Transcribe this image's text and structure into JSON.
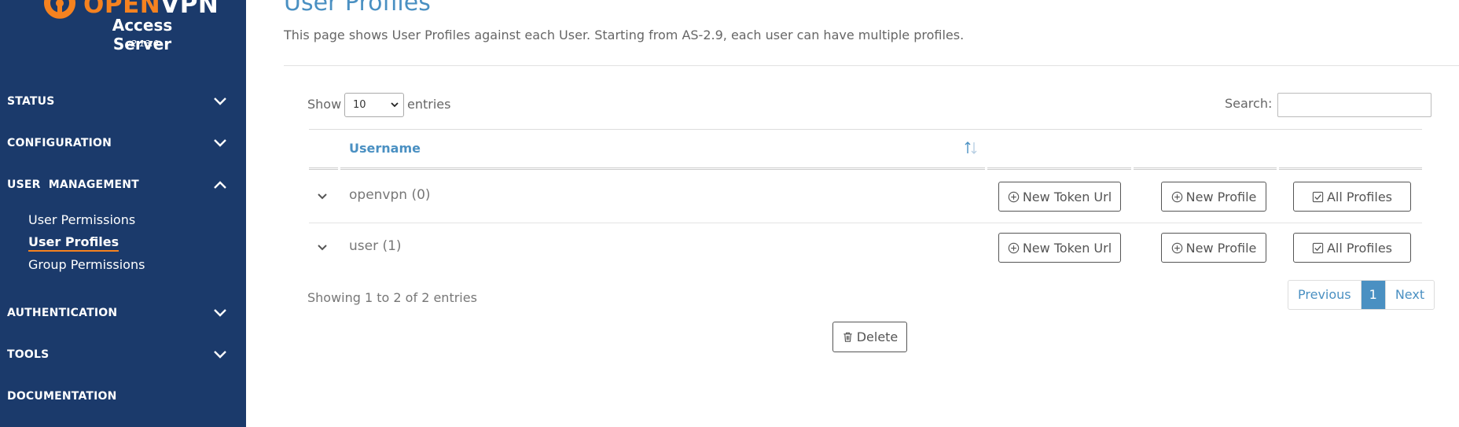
{
  "brand": {
    "name_part1": "OPEN",
    "name_part2": "VPN",
    "product": "Access Server",
    "version": "v2.13.0"
  },
  "sidebar": {
    "sections": [
      {
        "label": "STATUS",
        "expanded": false
      },
      {
        "label": "CONFIGURATION",
        "expanded": false
      },
      {
        "label": "USER  MANAGEMENT",
        "expanded": true
      },
      {
        "label": "AUTHENTICATION",
        "expanded": false
      },
      {
        "label": "TOOLS",
        "expanded": false
      },
      {
        "label": "DOCUMENTATION",
        "expanded": false
      }
    ],
    "user_management_items": [
      {
        "label": "User Permissions",
        "active": false
      },
      {
        "label": "User Profiles",
        "active": true
      },
      {
        "label": "Group Permissions",
        "active": false
      }
    ]
  },
  "page": {
    "title": "User Profiles",
    "description": "This page shows User Profiles against each User. Starting from AS-2.9, each user can have multiple profiles."
  },
  "table_controls": {
    "show_label": "Show",
    "entries_value": "10",
    "entries_label": "entries",
    "search_label": "Search:",
    "search_value": ""
  },
  "table": {
    "columns": [
      "Username"
    ],
    "rows": [
      {
        "username": "openvpn (0)",
        "actions": [
          "New Token Url",
          "New Profile",
          "All Profiles"
        ]
      },
      {
        "username": "user (1)",
        "actions": [
          "New Token Url",
          "New Profile",
          "All Profiles"
        ]
      }
    ]
  },
  "footer": {
    "showing": "Showing 1 to 2 of 2 entries",
    "pager": {
      "previous": "Previous",
      "current": "1",
      "next": "Next"
    },
    "delete_label": "Delete"
  },
  "colors": {
    "sidebar_bg": "#1b3a6b",
    "brand_orange": "#f58220",
    "accent_blue": "#4a90c2"
  }
}
